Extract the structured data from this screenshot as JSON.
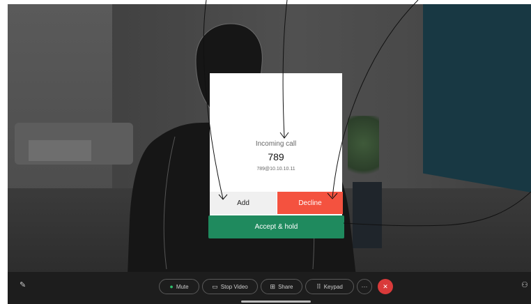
{
  "dialog": {
    "title": "Incoming call",
    "caller": "789",
    "address": "789@10.10.10.11",
    "add_label": "Add",
    "decline_label": "Decline",
    "accept_hold_label": "Accept & hold"
  },
  "toolbar": {
    "mute_label": "Mute",
    "stop_video_label": "Stop Video",
    "share_label": "Share",
    "keypad_label": "Keypad",
    "more_label": "···",
    "end_label": "✕"
  },
  "icons": {
    "edit": "pen-icon",
    "participants": "people-icon",
    "mute": "microphone-icon",
    "video": "camera-icon",
    "share": "share-icon",
    "keypad": "keypad-icon"
  },
  "colors": {
    "decline": "#f4523f",
    "accept": "#1f8a5e",
    "end_call": "#d93a3a",
    "toolbar": "#1d1d1d"
  }
}
